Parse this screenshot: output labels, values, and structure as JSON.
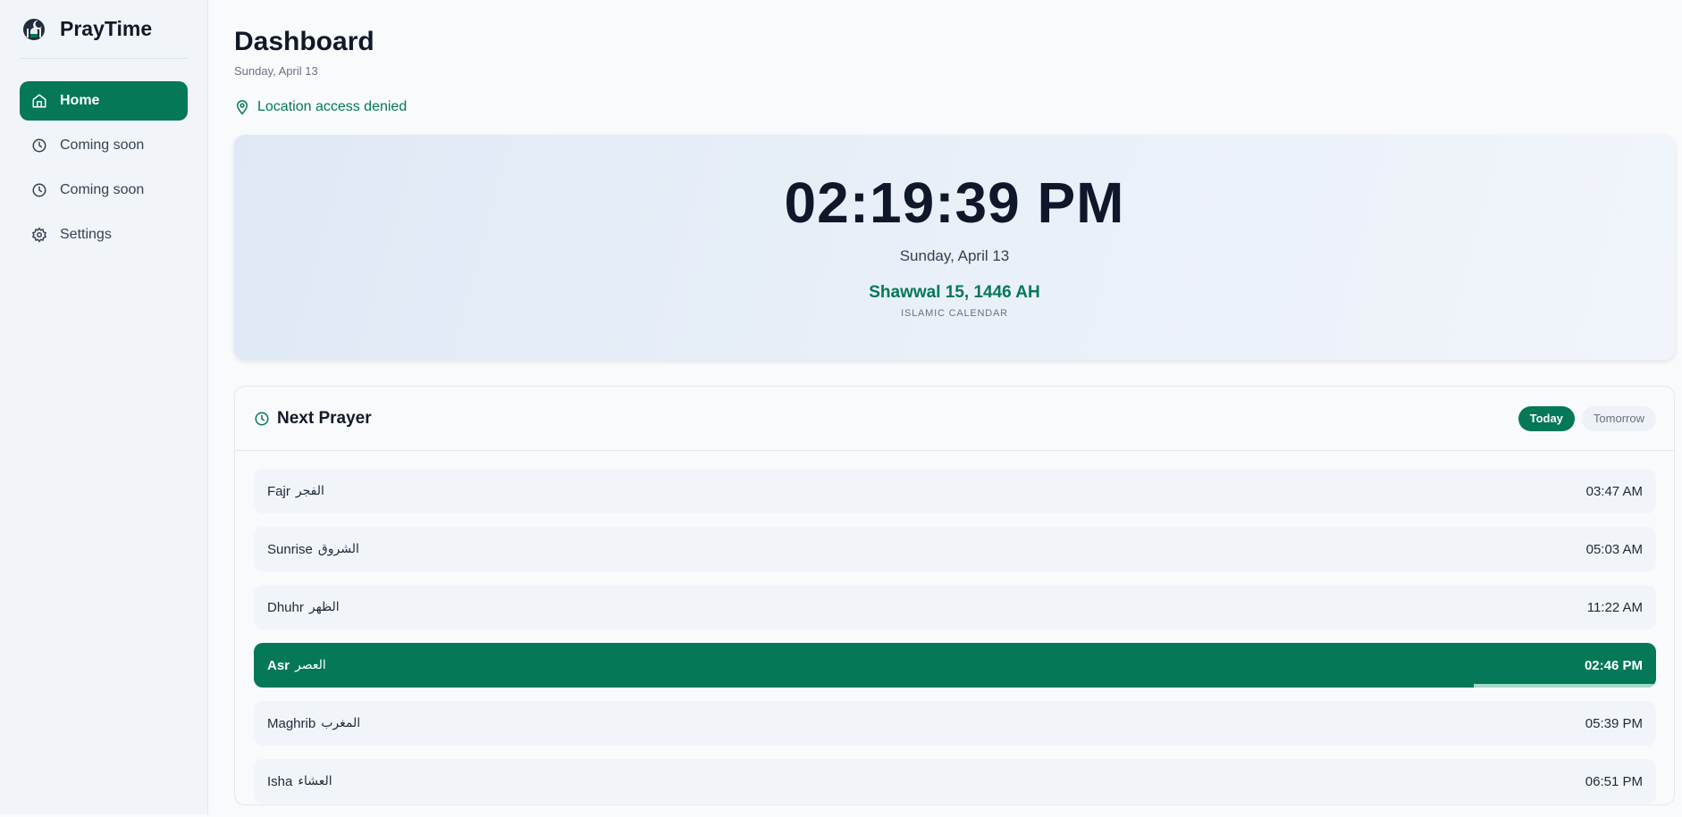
{
  "app": {
    "name": "PrayTime"
  },
  "sidebar": {
    "items": [
      {
        "label": "Home",
        "icon": "home-icon",
        "active": true
      },
      {
        "label": "Coming soon",
        "icon": "clock-icon",
        "active": false
      },
      {
        "label": "Coming soon",
        "icon": "clock-icon",
        "active": false
      },
      {
        "label": "Settings",
        "icon": "gear-icon",
        "active": false
      }
    ]
  },
  "header": {
    "title": "Dashboard",
    "date": "Sunday, April 13",
    "location_status": "Location access denied"
  },
  "clock": {
    "time": "02:19:39 PM",
    "date": "Sunday, April 13",
    "hijri": "Shawwal 15, 1446 AH",
    "hijri_label": "ISLAMIC CALENDAR"
  },
  "prayers": {
    "title": "Next Prayer",
    "toggle": {
      "today": "Today",
      "tomorrow": "Tomorrow",
      "selected": "Today"
    },
    "list": [
      {
        "name": "Fajr",
        "arabic": "الفجر",
        "time": "03:47 AM"
      },
      {
        "name": "Sunrise",
        "arabic": "الشروق",
        "time": "05:03 AM"
      },
      {
        "name": "Dhuhr",
        "arabic": "الظهر",
        "time": "11:22 AM"
      },
      {
        "name": "Asr",
        "arabic": "العصر",
        "time": "02:46 PM"
      },
      {
        "name": "Maghrib",
        "arabic": "المغرب",
        "time": "05:39 PM"
      },
      {
        "name": "Isha",
        "arabic": "العشاء",
        "time": "06:51 PM"
      }
    ],
    "current_index": 3,
    "current_progress_remaining_fraction": 0.13
  },
  "colors": {
    "accent": "#047857",
    "progress": "#a7d9c8",
    "sidebar_bg": "#f1f5f9"
  }
}
